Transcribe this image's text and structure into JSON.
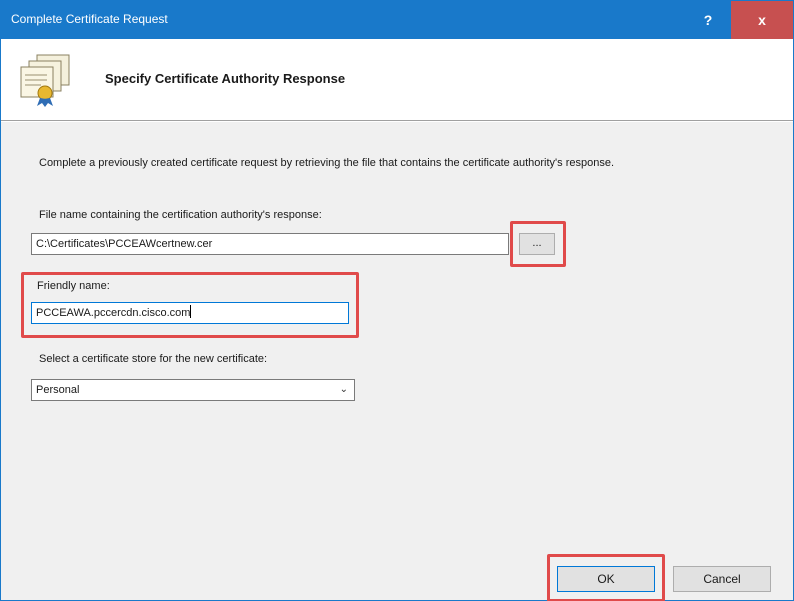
{
  "window": {
    "title": "Complete Certificate Request",
    "help_label": "?",
    "close_label": "x"
  },
  "header": {
    "title": "Specify Certificate Authority Response",
    "icon": "certificate-icon"
  },
  "form": {
    "description": "Complete a previously created certificate request by retrieving the file that contains the certificate authority's response.",
    "file_label": "File name containing the certification authority's response:",
    "file_value": "C:\\Certificates\\PCCEAWcertnew.cer",
    "browse_label": "...",
    "friendly_label": "Friendly name:",
    "friendly_value": "PCCEAWA.pccercdn.cisco.com",
    "store_label": "Select a certificate store for the new certificate:",
    "store_value": "Personal"
  },
  "buttons": {
    "ok": "OK",
    "cancel": "Cancel"
  },
  "colors": {
    "titlebar": "#1979ca",
    "close": "#c75050",
    "highlight": "#e04a4a"
  }
}
